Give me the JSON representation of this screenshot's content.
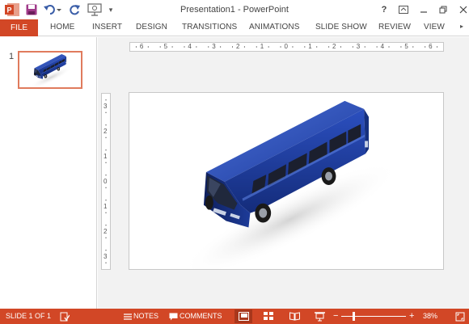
{
  "window": {
    "title": "Presentation1 - PowerPoint",
    "help": "?",
    "quick_access_more": "▾"
  },
  "ribbon": {
    "file_tab": "FILE",
    "tabs": [
      "HOME",
      "INSERT",
      "DESIGN",
      "TRANSITIONS",
      "ANIMATIONS",
      "SLIDE SHOW",
      "REVIEW",
      "VIEW"
    ],
    "scroll_right": "▸"
  },
  "thumbnails": [
    {
      "number": "1",
      "selected": true
    }
  ],
  "rulers": {
    "horizontal": [
      "6",
      "5",
      "4",
      "3",
      "2",
      "1",
      "0",
      "1",
      "2",
      "3",
      "4",
      "5",
      "6"
    ],
    "vertical": [
      "3",
      "2",
      "1",
      "0",
      "1",
      "2",
      "3"
    ]
  },
  "slide": {
    "image_icon": "bus-icon",
    "bus_color": "#1f3fa0"
  },
  "statusbar": {
    "slide_info": "SLIDE 1 OF 1",
    "notes": "NOTES",
    "comments": "COMMENTS",
    "zoom_minus": "−",
    "zoom_plus": "+",
    "zoom": "38%",
    "zoom_fraction": 0.38
  },
  "colors": {
    "accent": "#d24726",
    "thumb_border": "#e07b5d",
    "workspace": "#f2f2f2"
  }
}
